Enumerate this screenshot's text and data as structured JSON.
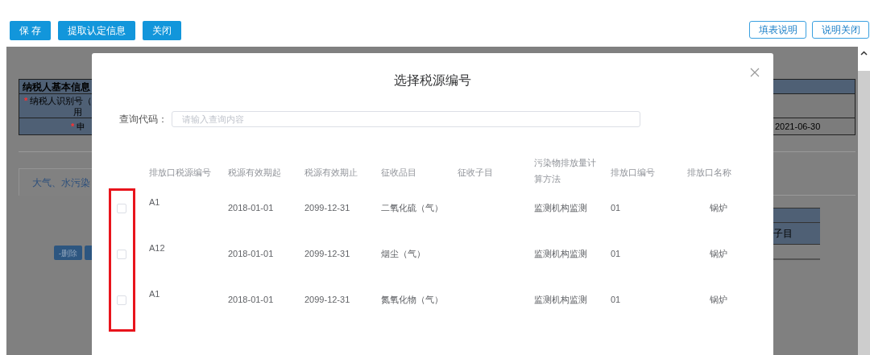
{
  "toolbar": {
    "left_buttons": [
      "保 存",
      "提取认定信息",
      "关闭"
    ],
    "right_buttons": [
      "填表说明",
      "说明关闭"
    ]
  },
  "background": {
    "info_header": "纳税人基本信息",
    "info_rows": [
      {
        "marker": "*",
        "label": "纳税人识别号（",
        "label_line2": "用"
      },
      {
        "marker": "*",
        "label": "申",
        "value": "2021-06-30"
      }
    ],
    "tab": "大气、水污染",
    "delete_button": "-删除",
    "sub_table_cell": "子目"
  },
  "dialog": {
    "title": "选择税源编号",
    "query": {
      "label": "查询代码：",
      "placeholder": "请输入查询内容"
    },
    "columns": [
      "排放口税源编号",
      "税源有效期起",
      "税源有效期止",
      "征收品目",
      "征收子目",
      "污染物排放量计算方法",
      "排放口编号",
      "排放口名称"
    ],
    "rows": [
      {
        "checked": false,
        "code": "A1",
        "start": "2018-01-01",
        "end": "2099-12-31",
        "item": "二氧化硫（气）",
        "method": "监测机构监测",
        "outlet_no": "01",
        "outlet_name": "锅炉"
      },
      {
        "checked": false,
        "code": "A12",
        "start": "2018-01-01",
        "end": "2099-12-31",
        "item": "烟尘（气）",
        "method": "监测机构监测",
        "outlet_no": "01",
        "outlet_name": "锅炉"
      },
      {
        "checked": false,
        "code": "A1",
        "start": "2018-01-01",
        "end": "2099-12-31",
        "item": "氮氧化物（气）",
        "method": "监测机构监测",
        "outlet_no": "01",
        "outlet_name": "锅炉"
      }
    ]
  }
}
